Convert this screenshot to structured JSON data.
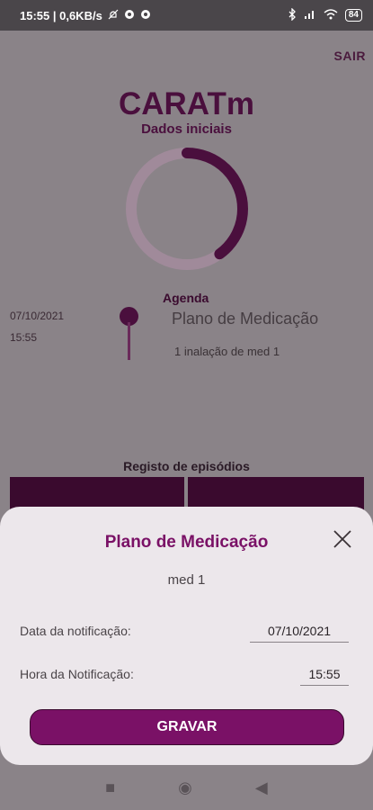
{
  "status_bar": {
    "time_and_speed": "15:55 | 0,6KB/s",
    "battery": "84"
  },
  "header": {
    "logout_label": "SAIR",
    "app_title": "CARATm",
    "subtitle": "Dados iniciais",
    "progress_fraction": 0.4
  },
  "agenda": {
    "title": "Agenda",
    "date": "07/10/2021",
    "time": "15:55",
    "event_title": "Plano de Medicação",
    "event_detail": "1 inalação de med 1"
  },
  "episodes": {
    "title": "Registo de episódios"
  },
  "modal": {
    "title": "Plano de Medicação",
    "medication": "med 1",
    "date_label": "Data da notificação:",
    "date_value": "07/10/2021",
    "time_label": "Hora da Notificação:",
    "time_value": "15:55",
    "save_label": "GRAVAR"
  },
  "colors": {
    "accent": "#7a1166",
    "dark_accent": "#3a0a2e"
  }
}
